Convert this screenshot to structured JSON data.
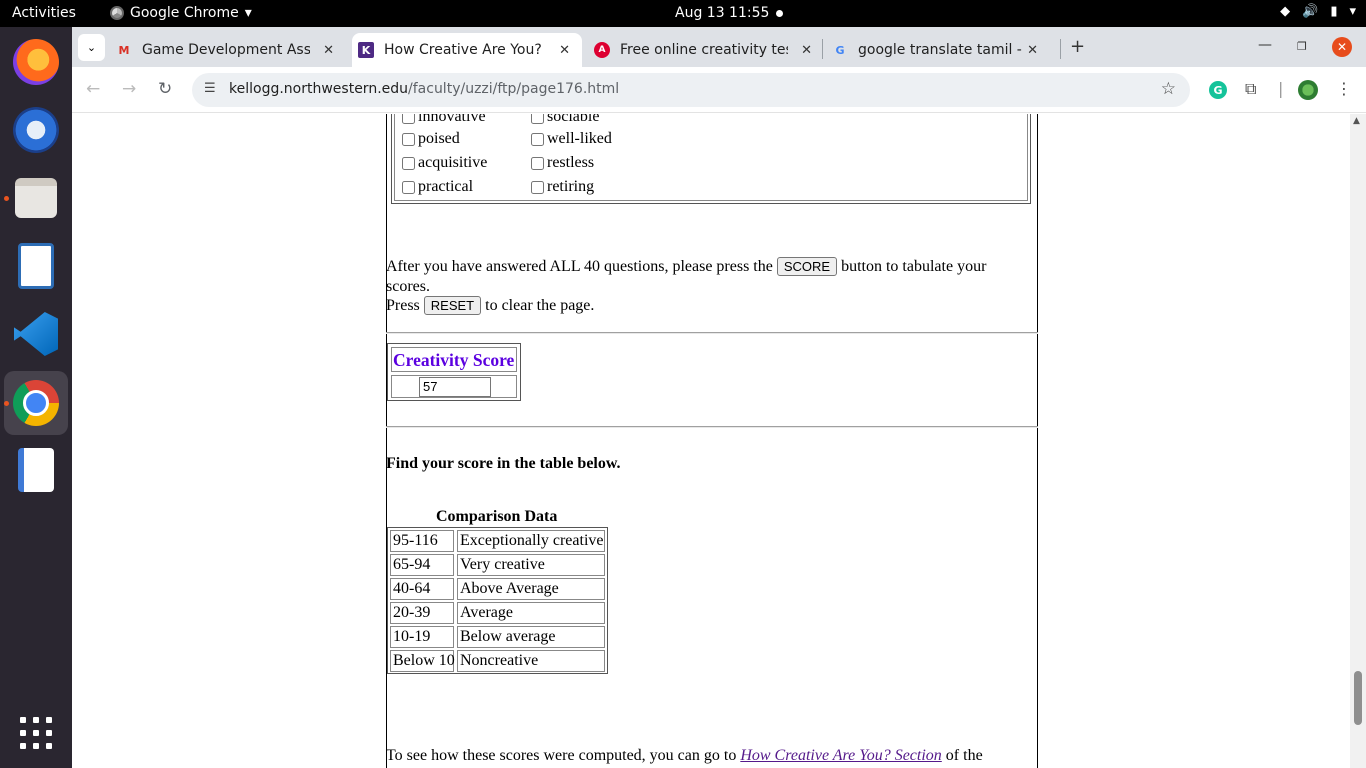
{
  "system": {
    "activities": "Activities",
    "app_name": "Google Chrome",
    "clock": "Aug 13  11:55"
  },
  "browser": {
    "tabs": [
      {
        "title": "Game Development Asso",
        "favicon": "gmail-icon"
      },
      {
        "title": "How Creative Are You?",
        "favicon": "kellogg-icon"
      },
      {
        "title": "Free online creativity tes",
        "favicon": "angular-icon"
      },
      {
        "title": "google translate tamil - G",
        "favicon": "google-icon"
      }
    ],
    "url_host": "kellogg.northwestern.edu",
    "url_path": "/faculty/uzzi/ftp/page176.html"
  },
  "page": {
    "adjectives": [
      [
        "innovative",
        "sociable"
      ],
      [
        "poised",
        "well-liked"
      ],
      [
        "acquisitive",
        "restless"
      ],
      [
        "practical",
        "retiring"
      ]
    ],
    "instructions_pre": "After you have answered ALL 40 questions, please press the",
    "score_button": "SCORE",
    "instructions_post": "button to tabulate your",
    "instructions_wrap": "scores.",
    "reset_pre": "Press",
    "reset_button": "RESET",
    "reset_post": "to clear the page.",
    "score_heading": "Creativity Score",
    "score_value": "57",
    "find_score": "Find your score in the table below.",
    "comparison_caption": "Comparison Data",
    "comparison_rows": [
      [
        "95-116",
        "Exceptionally creative"
      ],
      [
        "65-94",
        "Very creative"
      ],
      [
        "40-64",
        "Above Average"
      ],
      [
        "20-39",
        "Average"
      ],
      [
        "10-19",
        "Below average"
      ],
      [
        "Below 10",
        "Noncreative"
      ]
    ],
    "footer_pre": "To see how these scores were computed, you can go to",
    "footer_link": "How Creative Are You? Section",
    "footer_post": "of the"
  }
}
